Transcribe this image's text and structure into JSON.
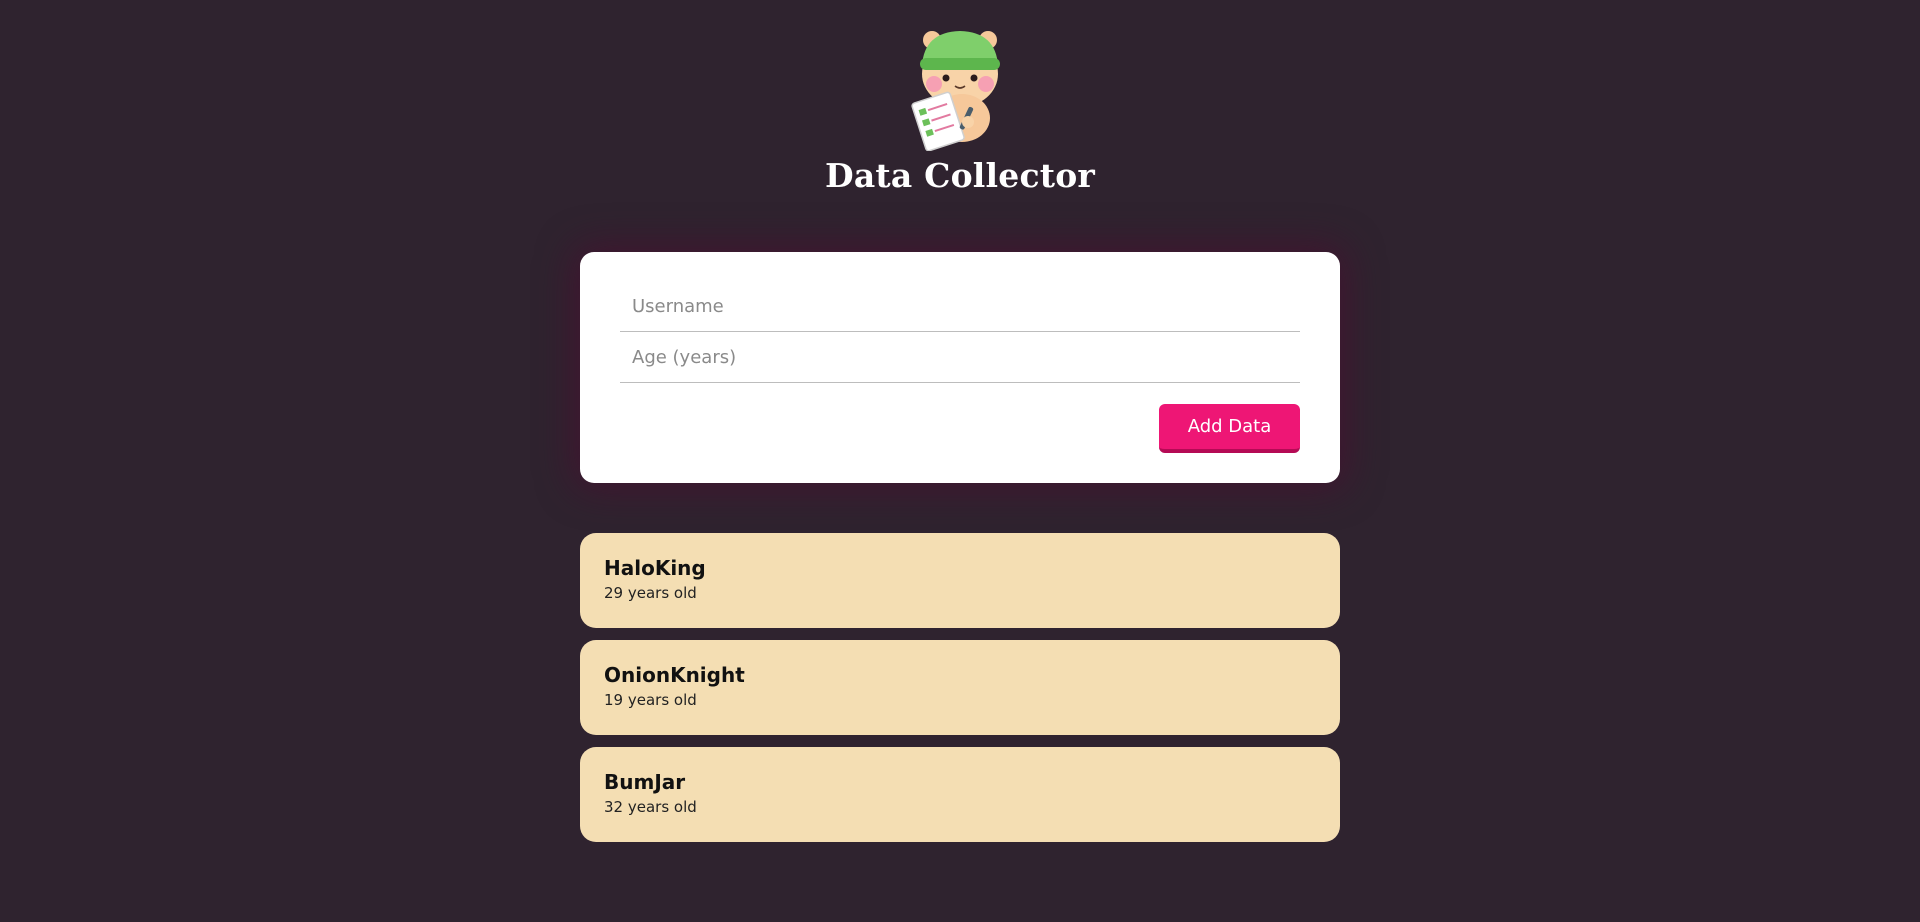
{
  "header": {
    "mascot": "hamster-with-clipboard-icon",
    "title": "Data Collector"
  },
  "form": {
    "username_placeholder": "Username",
    "age_placeholder": "Age (years)",
    "add_button_label": "Add Data"
  },
  "users": [
    {
      "name": "HaloKing",
      "age_text": "29 years old"
    },
    {
      "name": "OnionKnight",
      "age_text": "19 years old"
    },
    {
      "name": "BumJar",
      "age_text": "32 years old"
    }
  ],
  "colors": {
    "background": "#2f232f",
    "accent": "#ee1675",
    "card": "#f4deb3"
  }
}
